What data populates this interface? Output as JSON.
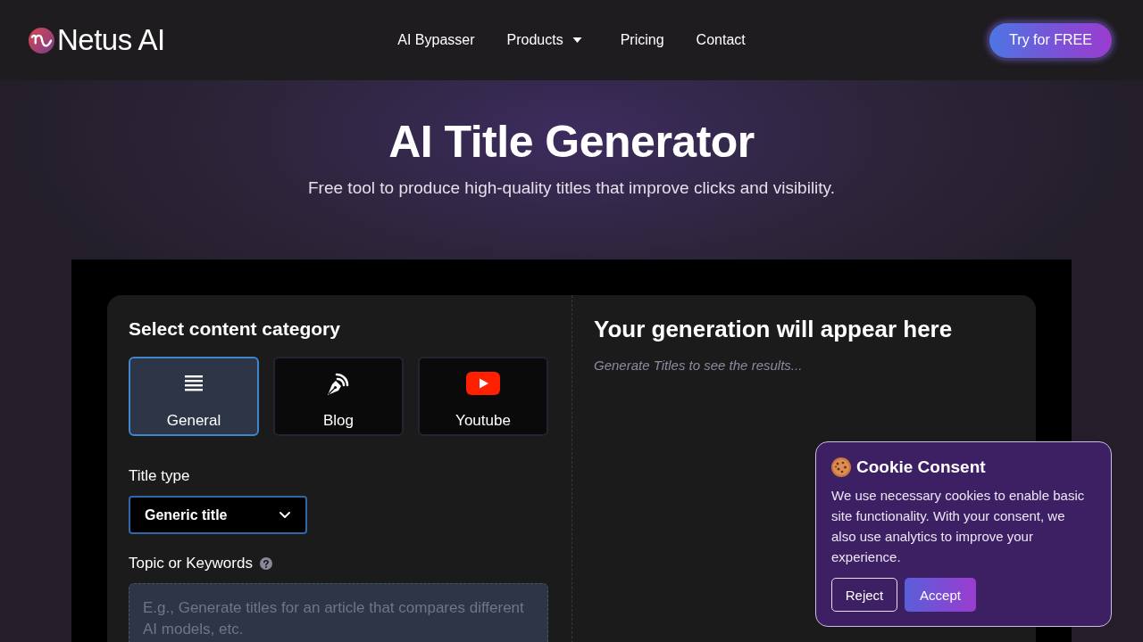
{
  "header": {
    "logo": {
      "text": "Netus AI"
    },
    "nav": [
      {
        "label": "AI Bypasser",
        "dropdown": false
      },
      {
        "label": "Products",
        "dropdown": true
      },
      {
        "label": "Pricing",
        "dropdown": false
      },
      {
        "label": "Contact",
        "dropdown": false
      }
    ],
    "cta": "Try for FREE"
  },
  "hero": {
    "title": "AI Title Generator",
    "subtitle": "Free tool to produce high-quality titles that improve clicks and visibility."
  },
  "tool": {
    "category_heading": "Select content category",
    "categories": [
      {
        "label": "General",
        "kind": "general",
        "selected": true
      },
      {
        "label": "Blog",
        "kind": "blog",
        "selected": false
      },
      {
        "label": "Youtube",
        "kind": "youtube",
        "selected": false
      }
    ],
    "title_type": {
      "label": "Title type",
      "value": "Generic title"
    },
    "topic": {
      "label": "Topic or Keywords",
      "placeholder": "E.g., Generate titles for an article that compares different AI models, etc."
    },
    "output": {
      "heading": "Your generation will appear here",
      "empty_text": "Generate Titles to see the results..."
    }
  },
  "cookie_banner": {
    "title": "Cookie Consent",
    "text": "We use necessary cookies to enable basic site functionality. With your consent, we also use analytics to improve your experience.",
    "buttons": [
      {
        "label": "Reject",
        "kind": "outline"
      },
      {
        "label": "Accept",
        "kind": "primary"
      }
    ]
  }
}
